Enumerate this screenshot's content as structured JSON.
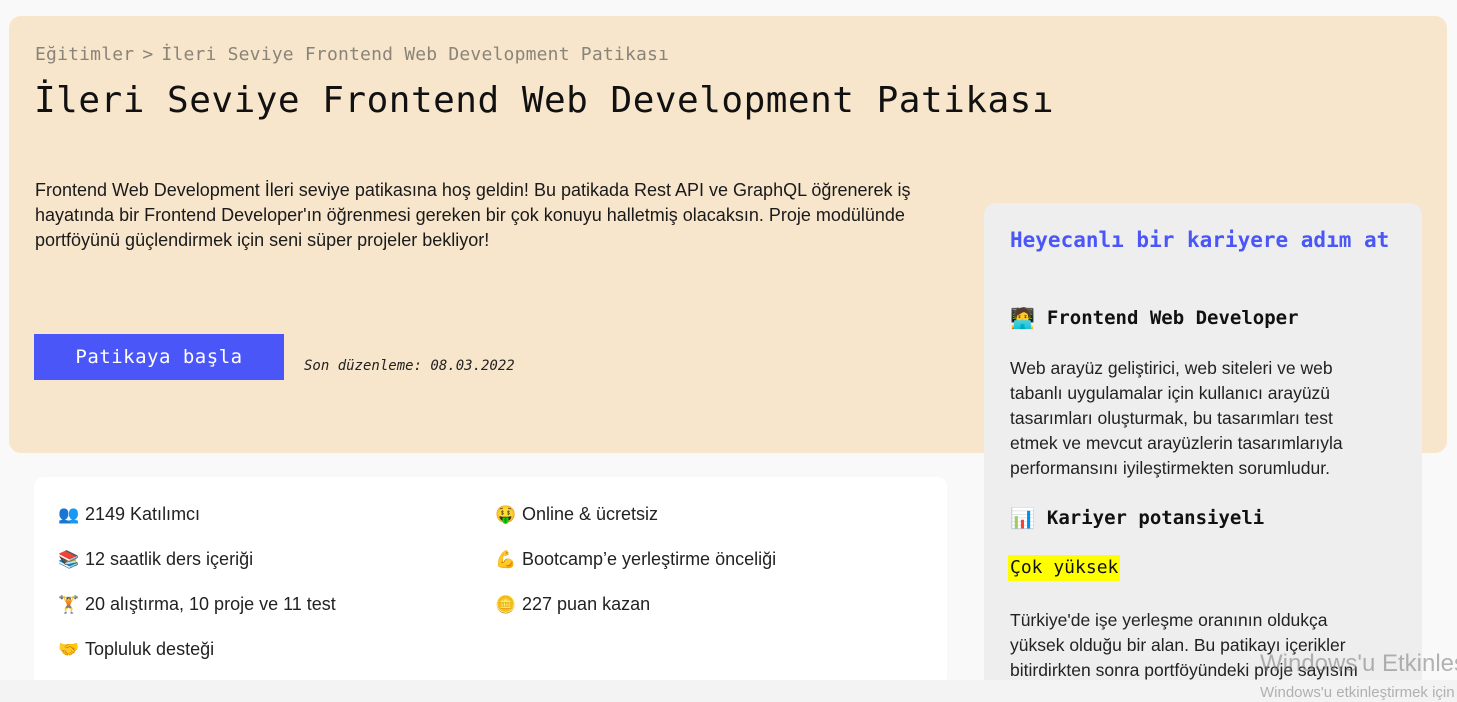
{
  "breadcrumb": {
    "root": "Eğitimler",
    "separator": ">",
    "current": "İleri Seviye Frontend Web Development Patikası"
  },
  "hero": {
    "title": "İleri Seviye Frontend Web Development Patikası",
    "description": "Frontend Web Development İleri seviye patikasına hoş geldin! Bu patikada Rest API ve GraphQL öğrenerek iş hayatında bir Frontend Developer'ın öğrenmesi gereken bir çok konuyu halletmiş olacaksın. Proje modülünde portföyünü güçlendirmek için seni süper projeler bekliyor!",
    "start_button": "Patikaya başla",
    "last_edited": "Son düzenleme: 08.03.2022"
  },
  "features": [
    {
      "icon": "people-icon",
      "glyph": "👥",
      "text": "2149 Katılımcı"
    },
    {
      "icon": "books-icon",
      "glyph": "📚",
      "text": "12 saatlik ders içeriği"
    },
    {
      "icon": "dumbbell-icon",
      "glyph": "🏋",
      "text": "20 alıştırma, 10 proje ve 11 test"
    },
    {
      "icon": "handshake-icon",
      "glyph": "🤝",
      "text": "Topluluk desteği"
    },
    {
      "icon": "money-face-icon",
      "glyph": "🤑",
      "text": "Online & ücretsiz"
    },
    {
      "icon": "flexed-biceps-icon",
      "glyph": "💪",
      "text": "Bootcamp’e yerleştirme önceliği"
    },
    {
      "icon": "coin-icon",
      "glyph": "🪙",
      "text": "227 puan kazan"
    }
  ],
  "career": {
    "title": "Heyecanlı bir kariyere adım at",
    "role_icon": "technologist-icon",
    "role_glyph": "🧑‍💻",
    "role": "Frontend Web Developer",
    "role_description": "Web arayüz geliştirici, web siteleri ve web tabanlı uygulamalar için kullanıcı arayüzü tasarımları oluşturmak, bu tasarımları test etmek ve mevcut arayüzlerin tasarımlarıyla performansını iyileştirmekten sorumludur.",
    "potential_icon": "chart-icon",
    "potential_glyph": "📊",
    "potential_title": "Kariyer potansiyeli",
    "potential_level": "Çok yüksek",
    "potential_description": "Türkiye'de işe yerleşme oranının oldukça yüksek olduğu bir alan. Bu patikayı içerikler bitirdirkten sonra portföyündeki proje sayısını"
  },
  "watermark": {
    "line1": "Windows'u Etkinleştir",
    "line2": "Windows'u etkinleştirmek için Ayarlar'a gidin."
  },
  "colors": {
    "hero_bg": "#f7e6cb",
    "accent": "#4a56f7",
    "highlight": "#ffff00",
    "card_bg": "#eeeeee"
  }
}
